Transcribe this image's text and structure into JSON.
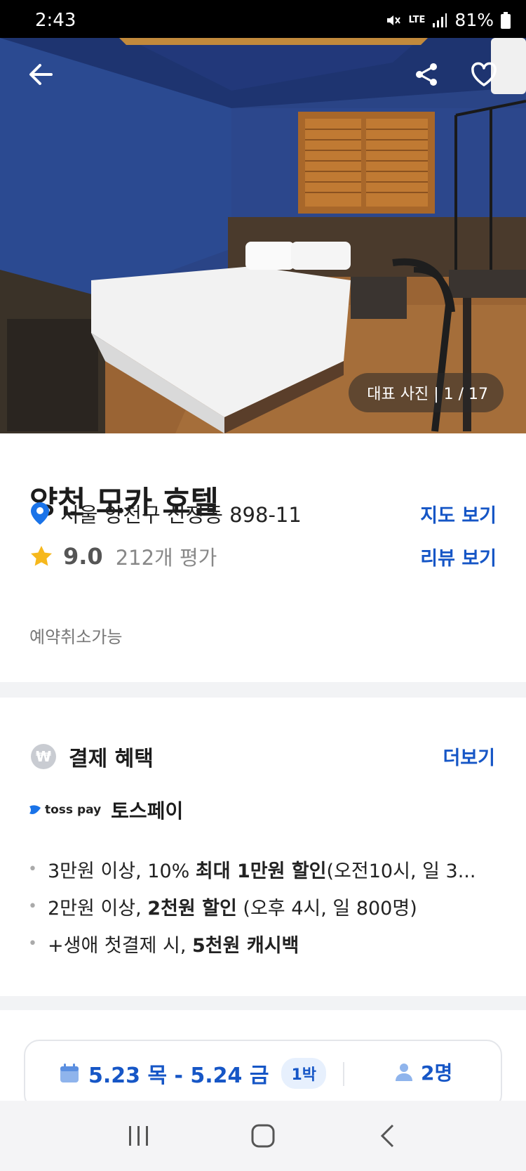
{
  "status_bar": {
    "time": "2:43",
    "network": "LTE",
    "battery": "81%"
  },
  "hero": {
    "photo_label": "대표 사진",
    "photo_index": "1",
    "photo_total": "17",
    "photo_counter": "대표 사진 | 1 / 17",
    "icons": [
      "back-arrow-icon",
      "share-icon",
      "heart-icon"
    ]
  },
  "hotel": {
    "name": "양천 모카 호텔",
    "address": "서울 양천구 신정동 898-11",
    "map_link": "지도 보기",
    "rating": "9.0",
    "review_count": "212개 평가",
    "review_link": "리뷰 보기",
    "cancel_note": "예약취소가능"
  },
  "benefits": {
    "title": "결제 혜택",
    "more": "더보기",
    "won_symbol": "₩",
    "provider_logo_text": "toss pay",
    "provider_name": "토스페이",
    "items": [
      {
        "pre": "3만원 이상, 10% ",
        "bold": "최대 1만원 할인",
        "post": "(오전10시, 일 3..."
      },
      {
        "pre": "2만원 이상, ",
        "bold": "2천원 할인",
        "post": " (오후 4시, 일 800명)"
      },
      {
        "pre": "+생애 첫결제 시, ",
        "bold": "5천원 캐시백",
        "post": ""
      }
    ]
  },
  "booking": {
    "dates": "5.23 목 - 5.24 금",
    "nights": "1박",
    "guests": "2명"
  },
  "colors": {
    "accent_blue": "#1656c6",
    "star_yellow": "#f6b81c",
    "pin_blue": "#1a73e8"
  }
}
